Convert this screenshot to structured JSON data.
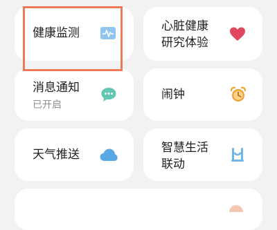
{
  "colors": {
    "page_bg": "#f2f2f4",
    "card_bg": "#ffffff",
    "highlight": "#ee7a55",
    "heart": "#e0475f",
    "chat": "#62c7b2",
    "alarm": "#f0a136",
    "cloud": "#58a8e6",
    "link": "#6fb6e8",
    "monitor": "#8ec6f0"
  },
  "cards": [
    {
      "label": "健康监测",
      "icon": "health-monitor-icon"
    },
    {
      "label_line1": "心脏健康",
      "label_line2": "研究体验",
      "icon": "heart-icon"
    },
    {
      "label": "消息通知",
      "status": "已开启",
      "icon": "chat-bubble-icon"
    },
    {
      "label": "闹钟",
      "icon": "alarm-clock-icon"
    },
    {
      "label": "天气推送",
      "icon": "cloud-icon"
    },
    {
      "label_line1": "智慧生活",
      "label_line2": "联动",
      "icon": "smart-link-icon"
    }
  ]
}
